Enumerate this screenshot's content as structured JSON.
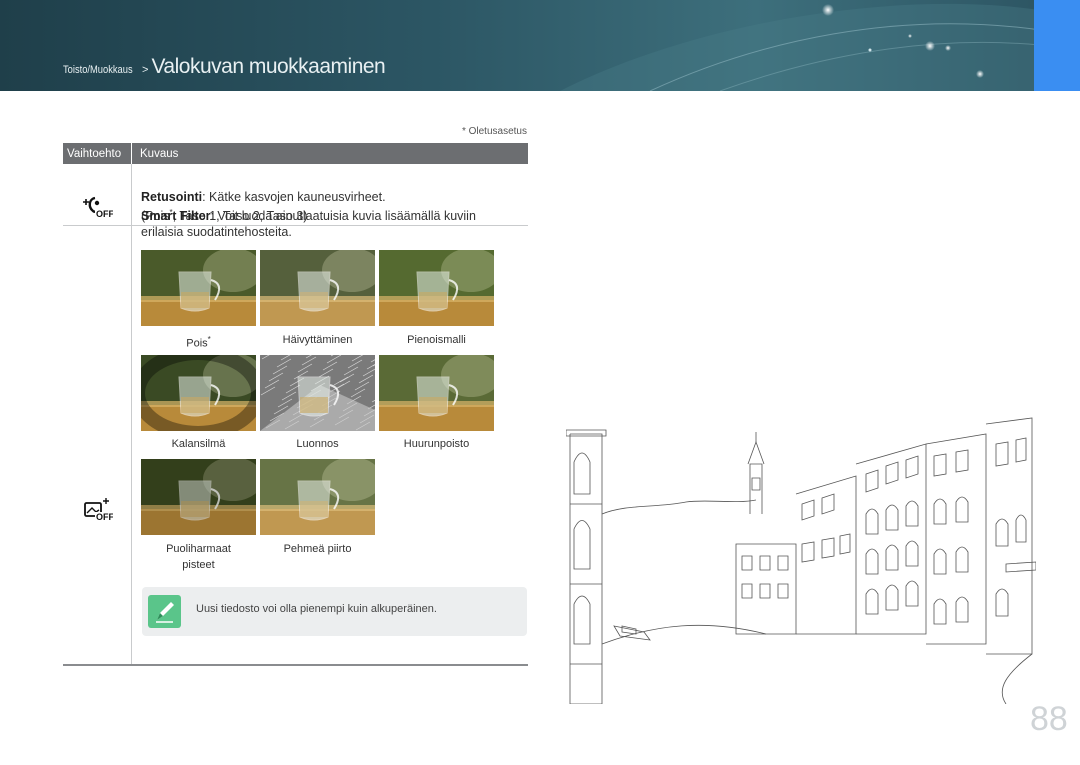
{
  "header": {
    "crumb_section": "Toisto/Muokkaus",
    "crumb_sep": " > ",
    "title": "Valokuvan muokkaaminen",
    "accent_color": "#3a8ef2"
  },
  "default_note": "* Oletusasetus",
  "table": {
    "col_option": "Vaihtoehto",
    "col_desc": "Kuvaus",
    "rows": [
      {
        "icon": "retouch-off-icon",
        "name": "Retusointi",
        "text": ": Kätke kasvojen kauneusvirheet.",
        "options_open": "(",
        "opt_off": "Pois",
        "star": "*",
        "opt_rest": ", Taso 1, Taso 2, Taso 3",
        "options_close": ")"
      },
      {
        "icon": "smart-filter-off-icon",
        "name": "Smart Filter",
        "text": ": Voit luoda ainutlaatuisia kuvia lisäämällä kuviin",
        "text2": "erilaisia suodatintehosteita."
      }
    ]
  },
  "samples": [
    {
      "label": "Pois",
      "star": "*"
    },
    {
      "label": "Häivyttäminen"
    },
    {
      "label": "Pienoismalli"
    },
    {
      "label": "Kalansilmä"
    },
    {
      "label": "Luonnos"
    },
    {
      "label": "Huurunpoisto"
    },
    {
      "label": "Puoliharmaat",
      "label2": "pisteet"
    },
    {
      "label": "Pehmeä piirto"
    }
  ],
  "note": {
    "icon": "note-pencil-icon",
    "text": "Uusi tiedosto voi olla pienempi kuin alkuperäinen."
  },
  "page_number": "88"
}
